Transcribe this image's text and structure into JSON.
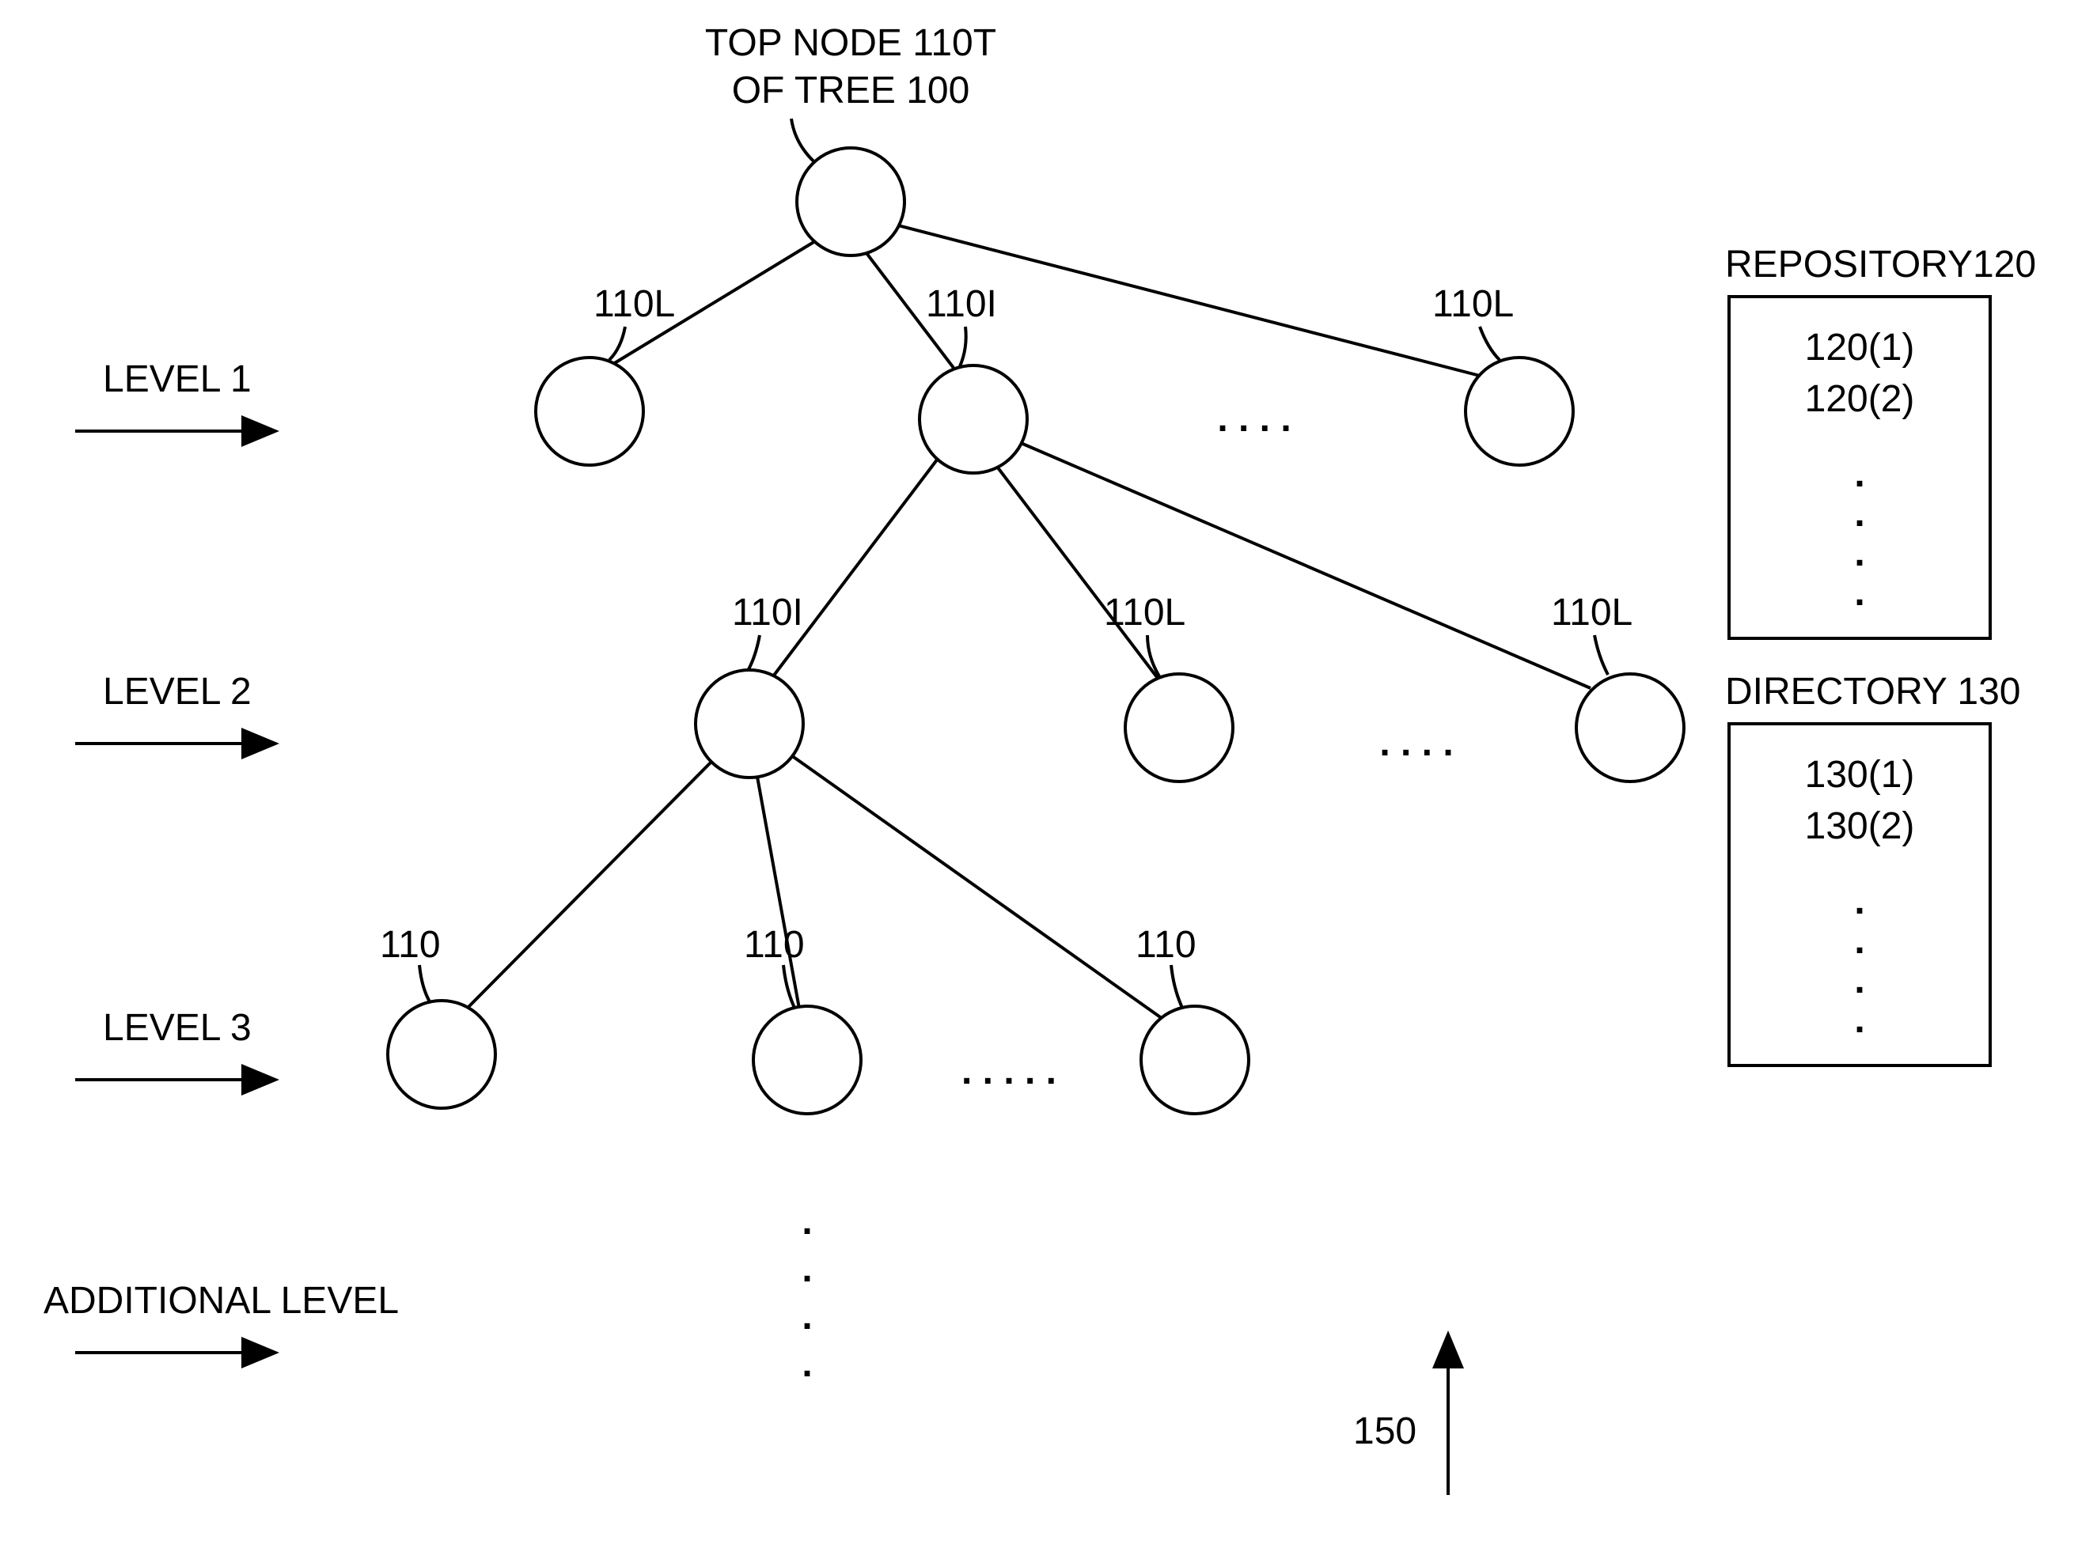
{
  "title": {
    "line1": "TOP NODE 110T",
    "line2": "OF TREE 100"
  },
  "levels": {
    "l1": "LEVEL 1",
    "l2": "LEVEL 2",
    "l3": "LEVEL 3",
    "add": "ADDITIONAL LEVEL"
  },
  "node_labels": {
    "l1_a": "110L",
    "l1_b": "110I",
    "l1_c": "110L",
    "l2_a": "110I",
    "l2_b": "110L",
    "l2_c": "110L",
    "l3_a": "110",
    "l3_b": "110",
    "l3_c": "110"
  },
  "ellipsis": {
    "dot": ".",
    "dots4": ". . . .",
    "dots5": ". . . . ."
  },
  "repository": {
    "title": "REPOSITORY120",
    "item1": "120(1)",
    "item2": "120(2)"
  },
  "directory": {
    "title": "DIRECTORY 130",
    "item1": "130(1)",
    "item2": "130(2)"
  },
  "arrow_label": "150"
}
